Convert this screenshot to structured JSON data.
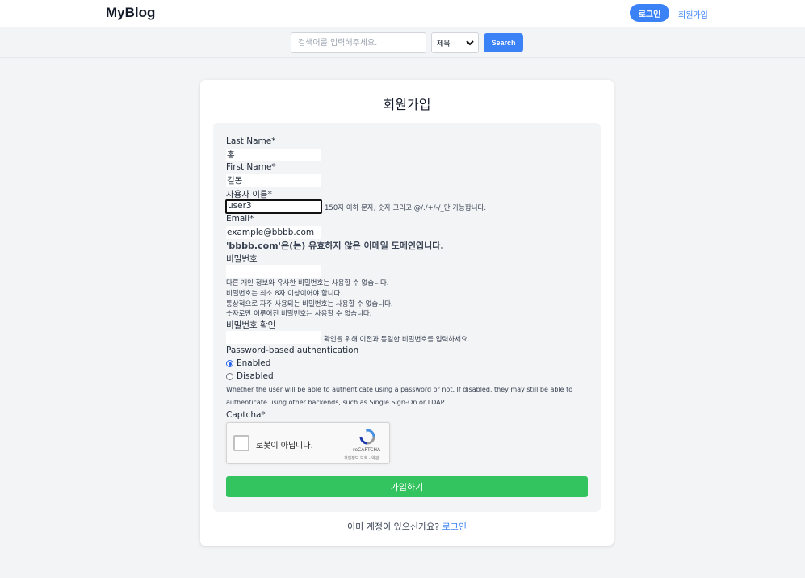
{
  "header": {
    "brand": "MyBlog",
    "login_label": "로그인",
    "signup_label": "회원가입"
  },
  "search": {
    "placeholder": "검색어를 입력해주세요.",
    "select_value": "제목",
    "button_label": "Search"
  },
  "form": {
    "title": "회원가입",
    "last_name": {
      "label": "Last Name*",
      "value": "홍"
    },
    "first_name": {
      "label": "First Name*",
      "value": "길동"
    },
    "username": {
      "label": "사용자 이름*",
      "value": "user3",
      "help": "150자 이하 문자, 숫자 그리고 @/./+/-/_만 가능합니다."
    },
    "email": {
      "label": "Email*",
      "value": "example@bbbb.com",
      "error": "'bbbb.com'은(는) 유효하지 않은 이메일 도메인입니다."
    },
    "password": {
      "label": "비밀번호",
      "help": [
        "다른 개인 정보와 유사한 비밀번호는 사용할 수 없습니다.",
        "비밀번호는 최소 8자 이상이어야 합니다.",
        "통상적으로 자주 사용되는 비밀번호는 사용할 수 없습니다.",
        "숫자로만 이루어진 비밀번호는 사용할 수 없습니다."
      ]
    },
    "password_confirm": {
      "label": "비밀번호 확인",
      "help": "확인을 위해 이전과 동일한 비밀번호를 입력하세요."
    },
    "auth": {
      "label": "Password-based authentication",
      "options": [
        "Enabled",
        "Disabled"
      ],
      "selected": "Enabled",
      "help_line1": "Whether the user will be able to authenticate using a password or not. If disabled, they may still be able to",
      "help_line2": "authenticate using other backends, such as Single Sign-On or LDAP."
    },
    "captcha": {
      "label": "Captcha*",
      "checkbox_text": "로봇이 아닙니다.",
      "brand": "reCAPTCHA",
      "terms": "개인정보 보호 - 약관"
    },
    "submit_label": "가입하기"
  },
  "footer": {
    "question": "이미 계정이 있으신가요?",
    "login_link": "로그인"
  },
  "colors": {
    "accent": "#3b82f6",
    "submit": "#33c35f"
  }
}
